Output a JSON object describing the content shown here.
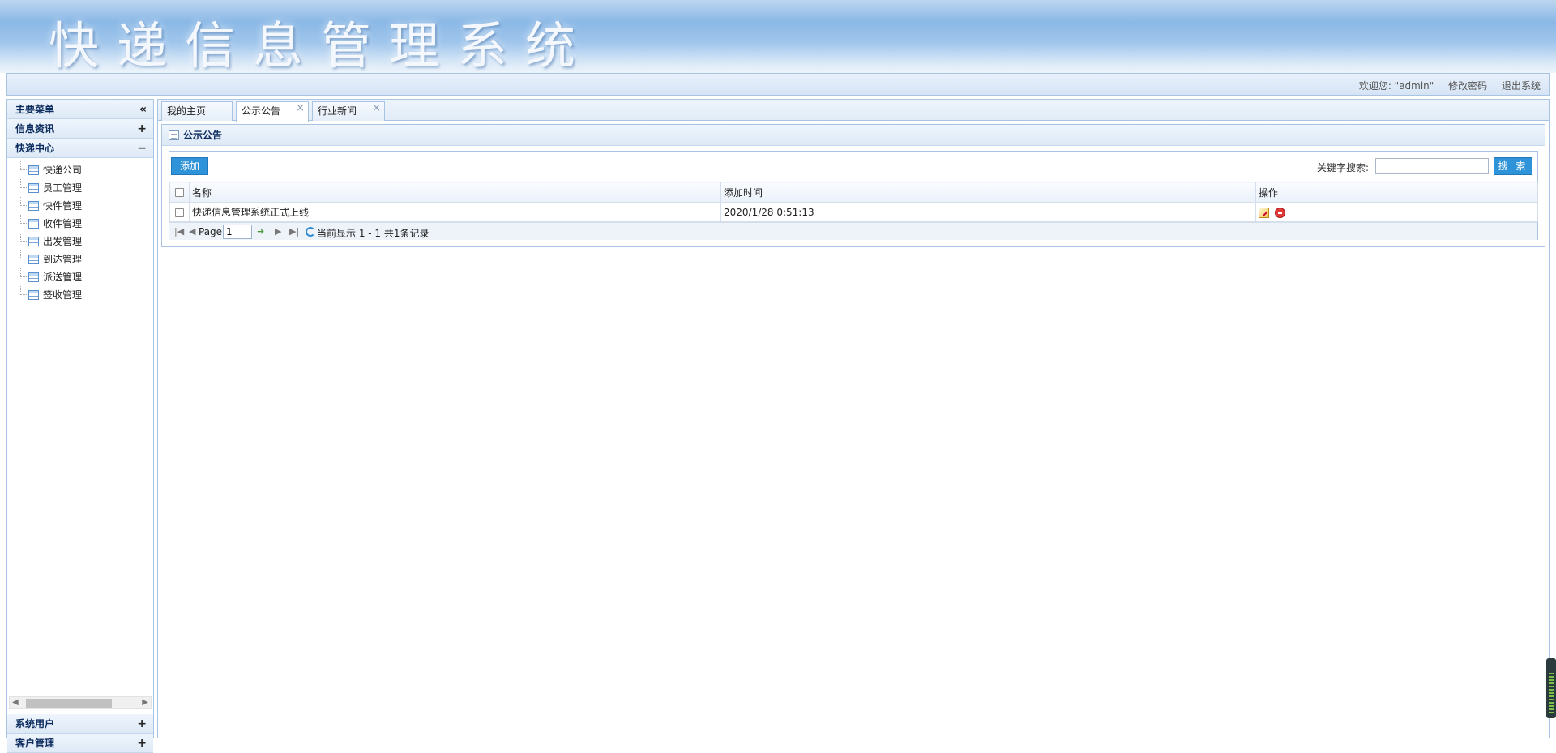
{
  "header": {
    "title": "快递信息管理系统"
  },
  "topbar": {
    "welcome": "欢迎您: \"admin\"",
    "change_password": "修改密码",
    "logout": "退出系统"
  },
  "menu": {
    "title": "主要菜单",
    "collapse_icon": "«",
    "sections": [
      {
        "label": "信息资讯",
        "icon": "+"
      },
      {
        "label": "快递中心",
        "icon": "−"
      }
    ],
    "items": [
      "快递公司",
      "员工管理",
      "快件管理",
      "收件管理",
      "出发管理",
      "到达管理",
      "派送管理",
      "签收管理"
    ],
    "bottom_sections": [
      {
        "label": "系统用户",
        "icon": "+"
      },
      {
        "label": "客户管理",
        "icon": "+"
      }
    ]
  },
  "tabs": [
    {
      "label": "我的主页",
      "closable": false
    },
    {
      "label": "公示公告",
      "closable": true
    },
    {
      "label": "行业新闻",
      "closable": true
    }
  ],
  "panel": {
    "title": "公示公告"
  },
  "toolbar": {
    "add_label": "添加",
    "search_label": "关键字搜索:",
    "search_value": "",
    "search_button": "搜 索"
  },
  "grid": {
    "columns": [
      "名称",
      "添加时间",
      "操作"
    ],
    "rows": [
      {
        "name": "快递信息管理系统正式上线",
        "time": "2020/1/28 0:51:13"
      }
    ]
  },
  "pager": {
    "page_label": "Page",
    "page_value": "1",
    "summary": "当前显示 1 - 1   共1条记录"
  },
  "colors": {
    "accent": "#2e93d8",
    "border": "#a9c4e2",
    "banner": "#8ab8e6"
  }
}
